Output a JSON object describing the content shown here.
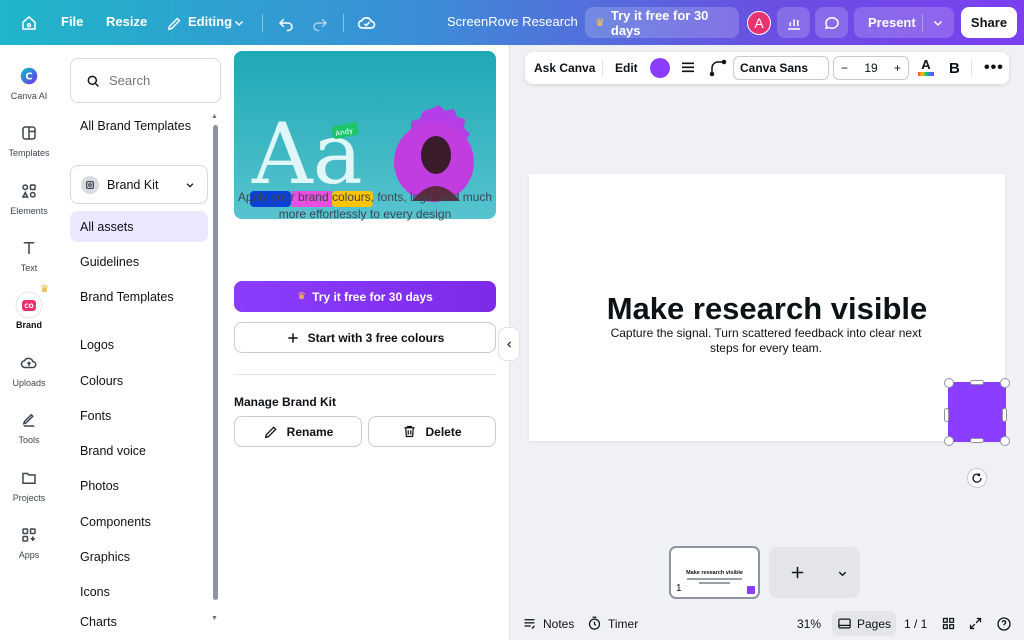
{
  "topbar": {
    "file": "File",
    "resize": "Resize",
    "editing": "Editing",
    "doc_title": "ScreenRove Research",
    "try_free": "Try it free for 30 days",
    "avatar_letter": "A",
    "present": "Present",
    "share": "Share"
  },
  "rail": [
    {
      "label": "Canva AI",
      "icon": "canva-ai-icon"
    },
    {
      "label": "Templates",
      "icon": "templates-icon"
    },
    {
      "label": "Elements",
      "icon": "elements-icon"
    },
    {
      "label": "Text",
      "icon": "text-icon"
    },
    {
      "label": "Brand",
      "icon": "brand-icon"
    },
    {
      "label": "Uploads",
      "icon": "uploads-icon"
    },
    {
      "label": "Tools",
      "icon": "tools-icon"
    },
    {
      "label": "Projects",
      "icon": "projects-icon"
    },
    {
      "label": "Apps",
      "icon": "apps-icon"
    }
  ],
  "panel": {
    "search_placeholder": "Search",
    "all_brand_templates": "All Brand Templates",
    "kit_name": "Brand Kit",
    "nav": [
      "All assets",
      "Guidelines",
      "Brand Templates",
      "Logos",
      "Colours",
      "Fonts",
      "Brand voice",
      "Photos",
      "Components",
      "Graphics",
      "Icons",
      "Charts"
    ],
    "hero_letters": "Aa",
    "hero_tag": "Andy",
    "hero_colors": [
      "#0a3fd8",
      "#e84fe0",
      "#ffc300"
    ],
    "description": "Apply your brand colours, fonts, logo, and much more effortlessly to every design",
    "try_free": "Try it free for 30 days",
    "start_colours": "Start with 3 free colours",
    "manage_title": "Manage Brand Kit",
    "rename": "Rename",
    "delete": "Delete"
  },
  "toolbar": {
    "ask": "Ask Canva",
    "edit": "Edit",
    "color": "#8b3dff",
    "font": "Canva Sans",
    "size": "19",
    "bold": "B"
  },
  "canvas": {
    "title": "Make research visible",
    "subtitle": "Capture the signal. Turn scattered feedback into clear next steps for every team.",
    "shape_color": "#8b3dff"
  },
  "pages": {
    "thumb_title": "Make research visible",
    "thumb_number": "1"
  },
  "bottombar": {
    "notes": "Notes",
    "timer": "Timer",
    "zoom": "31%",
    "pages": "Pages",
    "page_count": "1 / 1"
  },
  "colors": {
    "accent": "#8b3dff",
    "active_bg": "#ede6ff"
  }
}
